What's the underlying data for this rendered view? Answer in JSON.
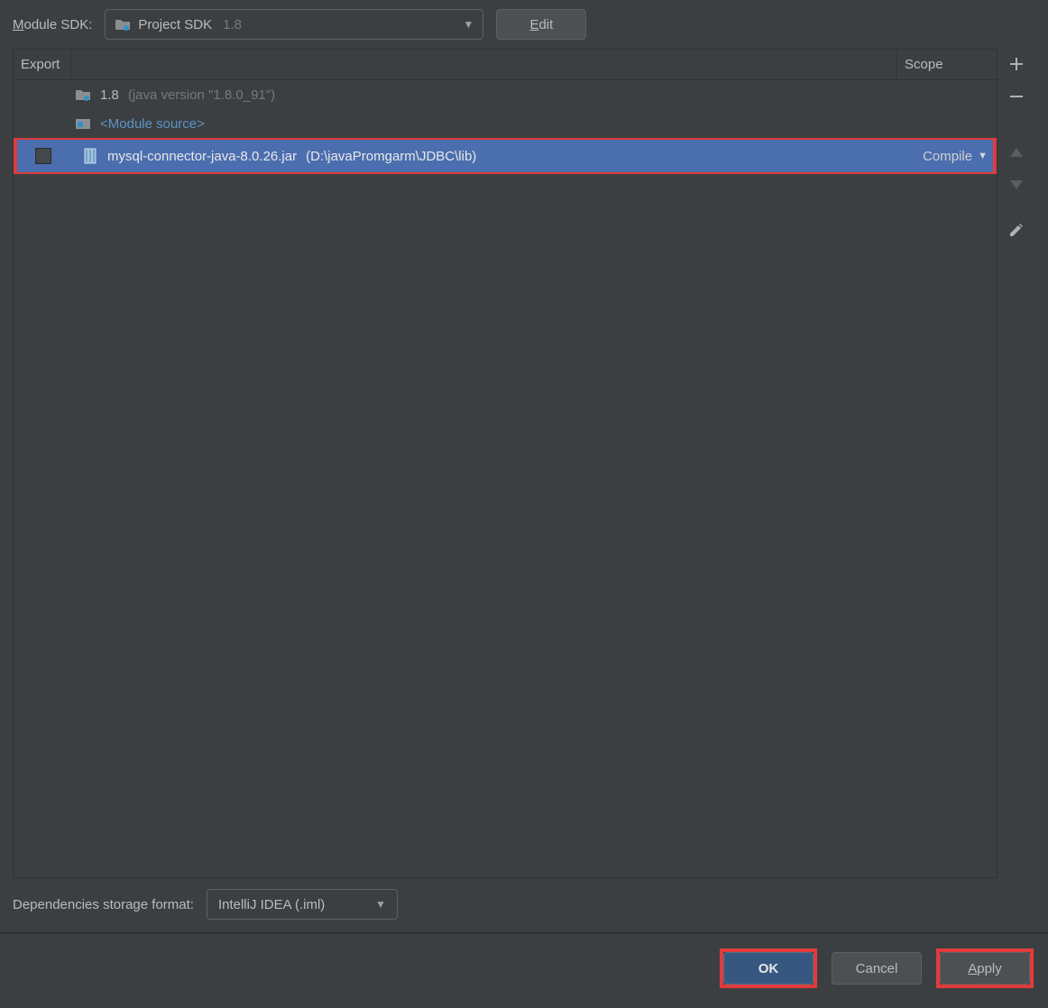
{
  "top": {
    "module_sdk_label": "Module SDK:",
    "sdk_name": "Project SDK",
    "sdk_ver": "1.8",
    "edit_label": "Edit"
  },
  "table": {
    "headers": {
      "export": "Export",
      "name": "",
      "scope": "Scope"
    },
    "rows": [
      {
        "type": "sdk",
        "name": "1.8",
        "detail": "(java version \"1.8.0_91\")"
      },
      {
        "type": "module_source",
        "name": "<Module source>"
      },
      {
        "type": "jar",
        "name": "mysql-connector-java-8.0.26.jar",
        "detail": "(D:\\javaPromgarm\\JDBC\\lib)",
        "scope": "Compile",
        "selected": true
      }
    ]
  },
  "storage": {
    "label": "Dependencies storage format:",
    "value": "IntelliJ IDEA (.iml)"
  },
  "footer": {
    "ok": "OK",
    "cancel": "Cancel",
    "apply": "Apply"
  }
}
